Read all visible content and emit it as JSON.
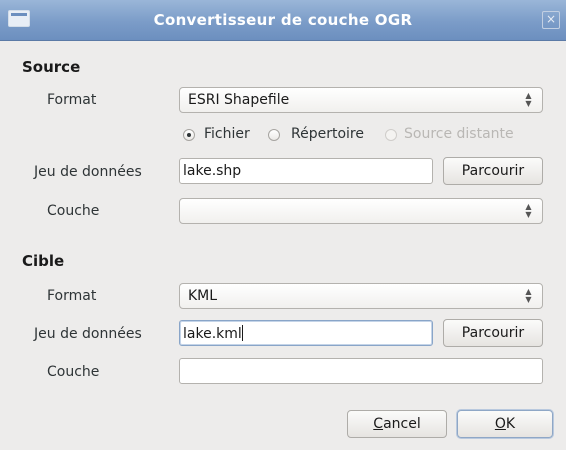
{
  "window": {
    "title": "Convertisseur de couche OGR",
    "close_glyph": "×"
  },
  "source": {
    "heading": "Source",
    "format_label": "Format",
    "format_value": "ESRI Shapefile",
    "radio_options": [
      {
        "label": "Fichier",
        "selected": true,
        "enabled": true
      },
      {
        "label": "Répertoire",
        "selected": false,
        "enabled": true
      },
      {
        "label": "Source distante",
        "selected": false,
        "enabled": false
      }
    ],
    "dataset_label": "Jeu de données",
    "dataset_value": "lake.shp",
    "browse_label": "Parcourir",
    "layer_label": "Couche",
    "layer_value": ""
  },
  "target": {
    "heading": "Cible",
    "format_label": "Format",
    "format_value": "KML",
    "dataset_label": "Jeu de données",
    "dataset_value": "lake.kml",
    "browse_label": "Parcourir",
    "layer_label": "Couche",
    "layer_value": ""
  },
  "footer": {
    "cancel_label_first": "C",
    "cancel_label_rest": "ancel",
    "ok_label_first": "O",
    "ok_label_rest": "K"
  },
  "icons": {
    "combo_arrows": "up-down-arrows-icon",
    "window": "window-menu-icon",
    "close": "close-icon"
  },
  "colors": {
    "titlebar": "#7b9cc8",
    "dialog_bg": "#edeceb",
    "focus_border": "#89a5c8"
  }
}
